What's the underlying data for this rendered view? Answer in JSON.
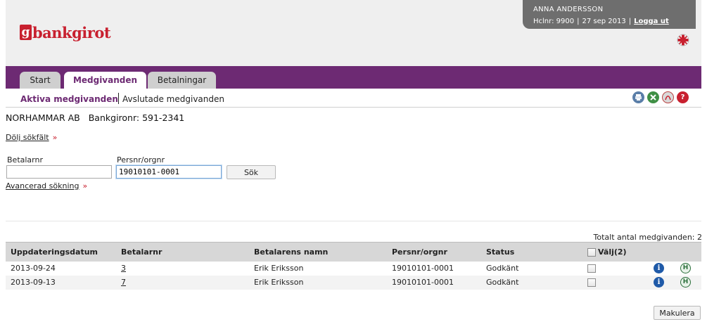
{
  "brand": {
    "logo_mark": "g",
    "logo_text": "bankgirot"
  },
  "user": {
    "name": "ANNA ANDERSSON",
    "customer_no": "Hclnr: 9900",
    "date": "27 sep 2013",
    "sep": "|",
    "logout": "Logga ut"
  },
  "tabs": [
    {
      "label": "Start"
    },
    {
      "label": "Medgivanden"
    },
    {
      "label": "Betalningar"
    }
  ],
  "subnav": {
    "active": "Aktiva medgivanden",
    "other": "Avslutade medgivanden"
  },
  "company": {
    "name": "NORHAMMAR AB",
    "bankgiro": "Bankgironr: 591-2341"
  },
  "search": {
    "toggle": "Dölj sökfält",
    "arrow": "»",
    "payer_label": "Betalarnr",
    "payer_value": "",
    "persnr_label": "Persnr/orgnr",
    "persnr_value": "19010101-0001",
    "search_button": "Sök",
    "advanced": "Avancerad sökning"
  },
  "summary": {
    "total": "Totalt antal medgivanden:  2"
  },
  "table": {
    "columns": [
      "Uppdateringsdatum",
      "Betalarnr",
      "Betalarens namn",
      "Persnr/orgnr",
      "Status",
      "Välj(2)"
    ],
    "rows": [
      {
        "date": "2013-09-24",
        "payer": "3",
        "name": "Erik Eriksson",
        "persnr": "19010101-0001",
        "status": "Godkänt"
      },
      {
        "date": "2013-09-13",
        "payer": "7",
        "name": "Erik Eriksson",
        "persnr": "19010101-0001",
        "status": "Godkänt"
      }
    ]
  },
  "actions": {
    "cancel": "Makulera"
  },
  "icons": {
    "print": "print-icon",
    "excel": "excel-icon",
    "pdf": "pdf-icon",
    "help": "help-icon",
    "info": "info-icon",
    "history": "history-icon",
    "flag": "uk-flag-icon"
  },
  "colors": {
    "brand_red": "#c8202f",
    "nav_purple": "#6d2a73",
    "user_box": "#6e6e6e"
  }
}
